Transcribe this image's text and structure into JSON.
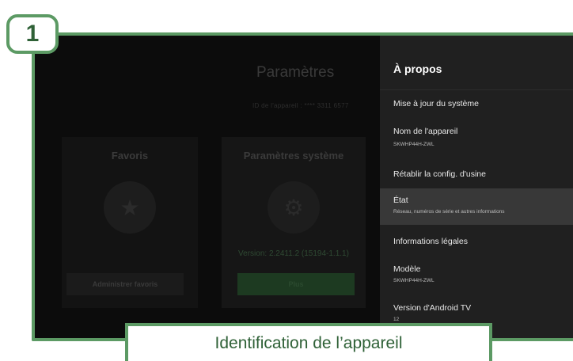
{
  "step_badge": "1",
  "background": {
    "title": "Paramètres",
    "device_id": "ID de l'appareil : **** 3311 6577",
    "cards": [
      {
        "title": "Favoris",
        "icon": "star-icon",
        "button": "Administrer favoris"
      },
      {
        "title": "Paramètres système",
        "icon": "gear-icon",
        "version": "Version: 2.2411.2 (15194-1.1.1)",
        "button": "Plus"
      }
    ]
  },
  "panel": {
    "title": "À propos",
    "items": [
      {
        "label": "Mise à jour du système"
      },
      {
        "label": "Nom de l'appareil",
        "sub": "SKWHP44H-ZWL"
      },
      {
        "label": "Rétablir la config. d'usine"
      },
      {
        "label": "État",
        "sub": "Réseau, numéros de série et autres informations",
        "selected": true
      },
      {
        "label": "Informations légales"
      },
      {
        "label": "Modèle",
        "sub": "SKWHP44H-ZWL"
      },
      {
        "label": "Version d'Android TV",
        "sub": "12"
      }
    ]
  },
  "caption": "Identification de l’appareil",
  "colors": {
    "frame_green": "#5c9a64",
    "caption_text": "#2f6137",
    "panel_bg": "#202020",
    "selected_bg": "#383838"
  }
}
